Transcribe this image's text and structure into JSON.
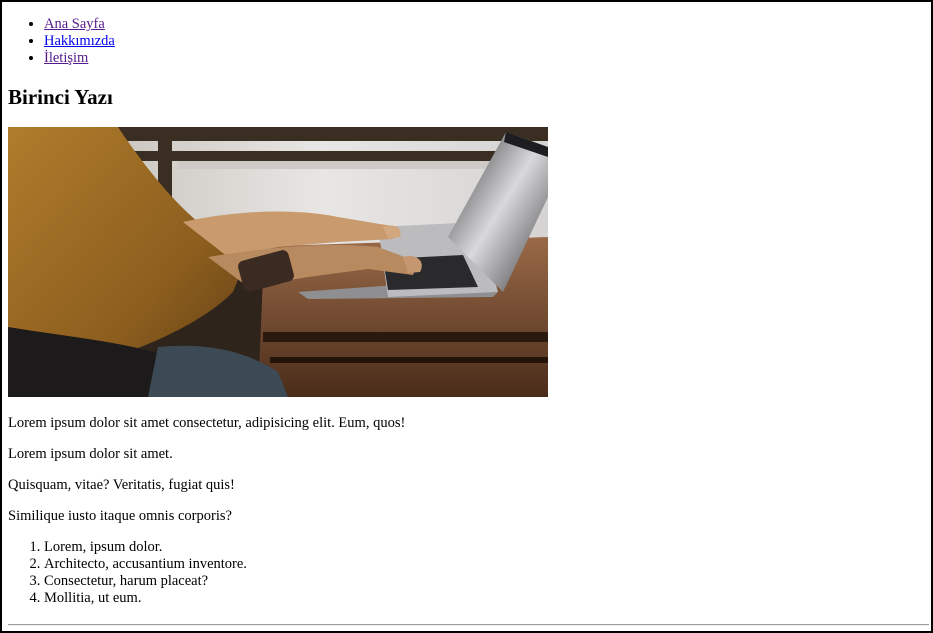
{
  "nav": {
    "items": [
      {
        "label": "Ana Sayfa"
      },
      {
        "label": "Hakkımızda"
      },
      {
        "label": "İletişim"
      }
    ]
  },
  "post": {
    "title": "Birinci Yazı",
    "image_alt": "person-typing-on-laptop",
    "paragraphs": [
      "Lorem ipsum dolor sit amet consectetur, adipisicing elit. Eum, quos!",
      "Lorem ipsum dolor sit amet.",
      "Quisquam, vitae? Veritatis, fugiat quis!",
      "Similique iusto itaque omnis corporis?"
    ],
    "list": [
      "Lorem, ipsum dolor.",
      "Architecto, accusantium inventore.",
      "Consectetur, harum placeat?",
      "Mollitia, ut eum."
    ]
  }
}
